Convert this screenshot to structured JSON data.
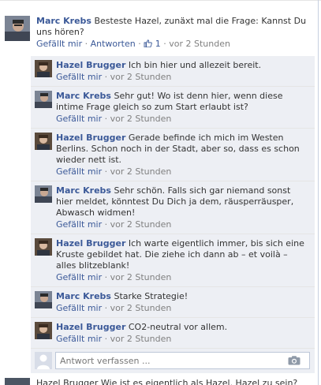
{
  "post": {
    "author": "Marc Krebs",
    "text": "Besteste Hazel, zunäxt mal die Frage: Kannst Du uns hören?",
    "like_label": "Gefällt mir",
    "reply_label": "Antworten",
    "like_count": "1",
    "time": "vor 2 Stunden",
    "sep": "·"
  },
  "comments": [
    {
      "author": "Hazel Brugger",
      "text": "Ich bin hier und allezeit bereit.",
      "like_label": "Gefällt mir",
      "time": "vor 2 Stunden"
    },
    {
      "author": "Marc Krebs",
      "text": "Sehr gut! Wo ist denn hier, wenn diese intime Frage gleich so zum Start erlaubt ist?",
      "like_label": "Gefällt mir",
      "time": "vor 2 Stunden"
    },
    {
      "author": "Hazel Brugger",
      "text": "Gerade befinde ich mich im Westen Berlins. Schon noch in der Stadt, aber so, dass es schon wieder nett ist.",
      "like_label": "Gefällt mir",
      "time": "vor 2 Stunden"
    },
    {
      "author": "Marc Krebs",
      "text": "Sehr schön. Falls sich gar niemand sonst hier meldet, könntest Du Dich ja dem, räusperräusper, Abwasch widmen!",
      "like_label": "Gefällt mir",
      "time": "vor 2 Stunden"
    },
    {
      "author": "Hazel Brugger",
      "text": "Ich warte eigentlich immer, bis sich eine Kruste gebildet hat. Die ziehe ich dann ab – et voilà – alles blitzeblank!",
      "like_label": "Gefällt mir",
      "time": "vor 2 Stunden"
    },
    {
      "author": "Marc Krebs",
      "text": "Starke Strategie!",
      "like_label": "Gefällt mir",
      "time": "vor 2 Stunden"
    },
    {
      "author": "Hazel Brugger",
      "text": "CO2-neutral vor allem.",
      "like_label": "Gefällt mir",
      "time": "vor 2 Stunden"
    }
  ],
  "reply_box": {
    "placeholder": "Antwort verfassen ...",
    "icon": "camera-icon"
  },
  "next_post": {
    "text": "Hazel Brugger  Wie ist es eigentlich als Hazel. Hazel zu sein?"
  },
  "colors": {
    "link": "#3b5998",
    "comment_bg": "#edeff4",
    "meta": "#808080",
    "text": "#333333"
  }
}
